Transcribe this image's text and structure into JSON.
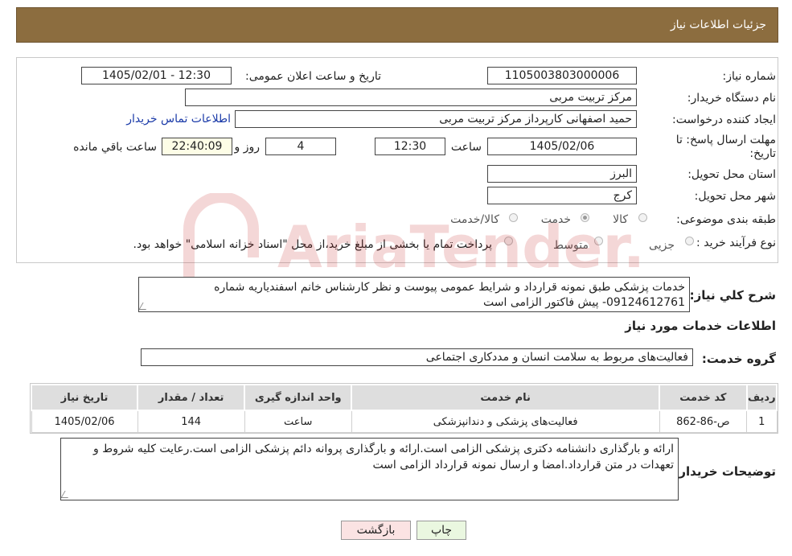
{
  "header": {
    "title": "جزئیات اطلاعات نیاز"
  },
  "fields": {
    "need_number_label": "شماره نیاز:",
    "need_number": "1105003803000006",
    "announce_label": "تاریخ و ساعت اعلان عمومی:",
    "announce_value": "1405/02/01 - 12:30",
    "buyer_org_label": "نام دستگاه خریدار:",
    "buyer_org": "مرکز تربیت مربی",
    "creator_label": "ایجاد کننده درخواست:",
    "creator": "حمید اصفهانی کارپرداز مرکز تربیت مربی",
    "contact_link": "اطلاعات تماس خریدار",
    "deadline_label": "مهلت ارسال پاسخ: تا تاریخ:",
    "deadline_date": "1405/02/06",
    "time_label": "ساعت",
    "deadline_time": "12:30",
    "days_value": "4",
    "days_label": "روز و",
    "remaining_time": "22:40:09",
    "remaining_label": "ساعت باقي مانده",
    "province_label": "استان محل تحویل:",
    "province": "البرز",
    "city_label": "شهر محل تحویل:",
    "city": "کرج",
    "category_label": "طبقه بندی موضوعی:",
    "category_options": [
      "کالا",
      "خدمت",
      "کالا/خدمت"
    ],
    "category_selected": "خدمت",
    "process_label": "نوع فرآیند خرید :",
    "process_options": [
      "جزیی",
      "متوسط"
    ],
    "process_note": "پرداخت تمام یا بخشی از مبلغ خرید،از محل \"اسناد خزانه اسلامی\" خواهد بود."
  },
  "description": {
    "label": "شرح کلي نياز:",
    "text": "خدمات پزشکی طبق نمونه قرارداد و شرایط عمومی پیوست و نظر کارشناس خانم اسفندیاریه شماره 09124612761- پیش فاکتور الزامی است"
  },
  "services": {
    "section_title": "اطلاعات خدمات مورد نياز",
    "group_label": "گروه خدمت:",
    "group_value": "فعالیت‌های مربوط به سلامت انسان و مددکاری اجتماعی",
    "columns": [
      "رديف",
      "کد خدمت",
      "نام خدمت",
      "واحد اندازه گيری",
      "تعداد / مقدار",
      "تاريخ نياز"
    ],
    "rows": [
      [
        "1",
        "ص-86-862",
        "فعالیت‌های پزشکی و دندانپزشکی",
        "ساعت",
        "144",
        "1405/02/06"
      ]
    ]
  },
  "buyer_notes": {
    "label": "توضيحات خريدار:",
    "text": "ارائه و بارگذاری دانشنامه دکتری پزشکی الزامی است.ارائه و بارگذاری پروانه دائم پزشکی الزامی است.رعایت کلیه شروط و تعهدات در متن قرارداد.امضا و ارسال نمونه قرارداد الزامی است"
  },
  "buttons": {
    "print": "چاپ",
    "back": "بازگشت"
  },
  "watermark": {
    "text": "AriaTender.neT"
  },
  "colors": {
    "header_bg": "#8c6d3f",
    "link": "#1a3aa8",
    "back_button_bg": "#fbe3e3",
    "print_button_bg": "#eaf7e0"
  }
}
